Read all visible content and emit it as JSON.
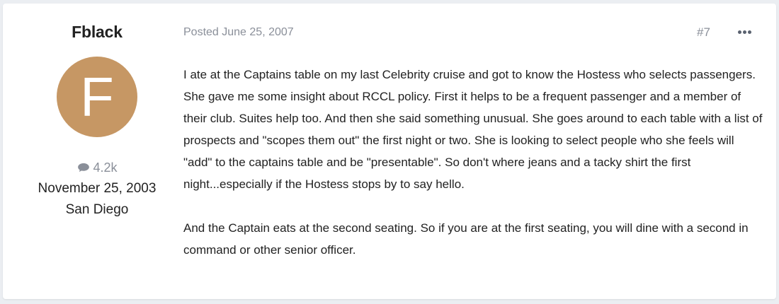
{
  "author": {
    "name": "Fblack",
    "avatar_letter": "F",
    "avatar_color": "#c69764",
    "post_count": "4.2k",
    "post_count_icon": "chat-bubble-icon",
    "join_date": "November 25, 2003",
    "location": "San Diego"
  },
  "post": {
    "posted": "Posted June 25, 2007",
    "number": "#7",
    "more_icon": "ellipsis-icon",
    "paragraphs": [
      "I ate at the Captains table on my last Celebrity cruise and got to know the Hostess who selects passengers. She gave me some insight about RCCL policy. First it helps to be a frequent passenger and a member of their club. Suites help too. And then she said something unusual. She goes around to each table with a list of prospects and \"scopes them out\" the first night or two. She is looking to select people who she feels will \"add\" to the captains table and be \"presentable\". So don't where jeans and a tacky shirt the first night...especially if the Hostess stops by to say hello.",
      "And the Captain eats at the second seating. So if you are at the first seating, you will dine with a second in command or other senior officer."
    ]
  }
}
